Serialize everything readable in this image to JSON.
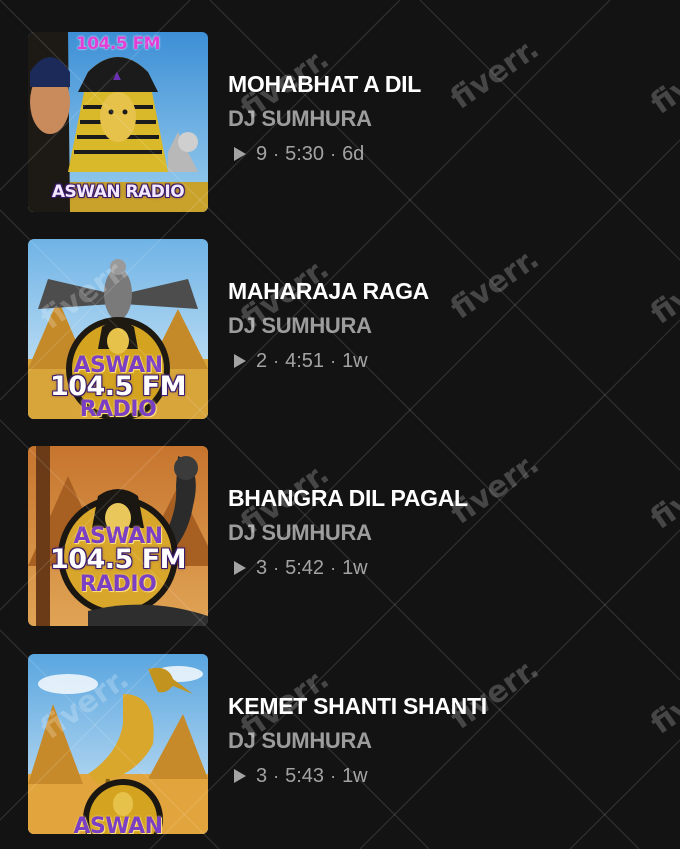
{
  "tracks": [
    {
      "title": "MOHABHAT A DIL",
      "artist": "DJ SUMHURA",
      "plays": "9",
      "duration": "5:30",
      "age": "6d",
      "art": {
        "top": "104.5 FM",
        "band": "ASWAN RADIO"
      }
    },
    {
      "title": "MAHARAJA RAGA",
      "artist": "DJ SUMHURA",
      "plays": "2",
      "duration": "4:51",
      "age": "1w",
      "art": {
        "band": "ASWAN",
        "big": "104.5 FM",
        "bottom": "RADIO"
      }
    },
    {
      "title": "BHANGRA DIL PAGAL",
      "artist": "DJ SUMHURA",
      "plays": "3",
      "duration": "5:42",
      "age": "1w",
      "art": {
        "band": "ASWAN",
        "big": "104.5 FM",
        "bottom": "RADIO"
      }
    },
    {
      "title": "KEMET SHANTI SHANTI",
      "artist": "DJ SUMHURA",
      "plays": "3",
      "duration": "5:43",
      "age": "1w",
      "art": {
        "band": "ASWAN"
      }
    }
  ],
  "meta_separator": "·",
  "watermark_text": "fiverr.",
  "icons": {
    "play": "play-icon"
  },
  "colors": {
    "background": "#131313",
    "title": "#ffffff",
    "artist": "#9c9c9c",
    "meta": "#a3a3a3"
  }
}
